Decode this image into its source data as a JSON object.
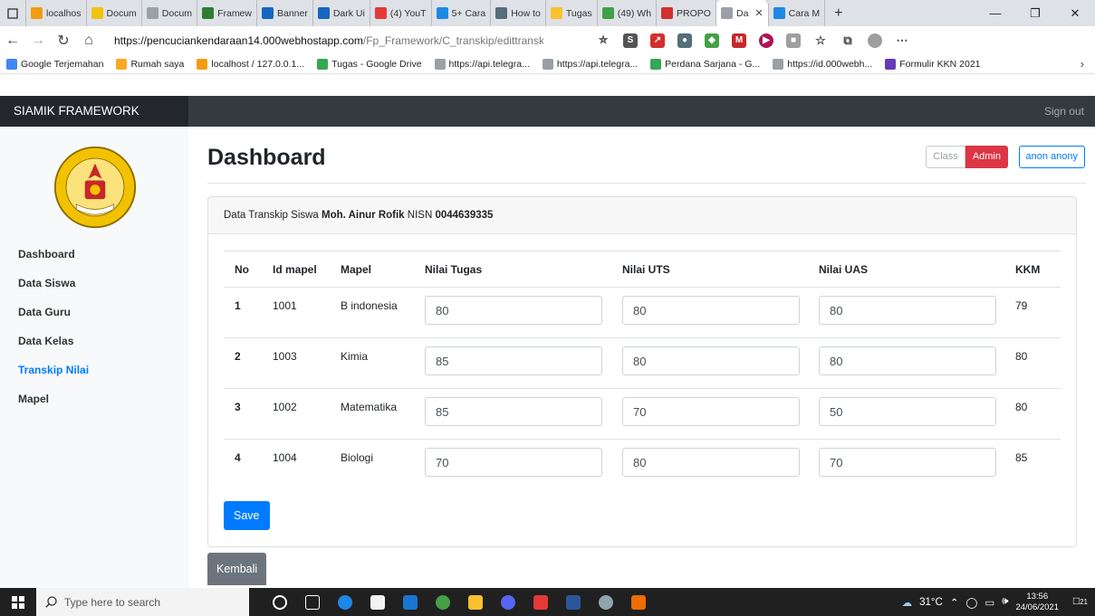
{
  "browser": {
    "tabs": [
      {
        "label": "localhos",
        "color": "#f39c12"
      },
      {
        "label": "Docum",
        "color": "#f1c40f"
      },
      {
        "label": "Docum",
        "color": "#9aa0a6"
      },
      {
        "label": "Framew",
        "color": "#2e7d32"
      },
      {
        "label": "Banner",
        "color": "#1565c0"
      },
      {
        "label": "Dark Ui",
        "color": "#1565c0"
      },
      {
        "label": "(4) YouT",
        "color": "#e53935"
      },
      {
        "label": "5+ Cara",
        "color": "#1e88e5"
      },
      {
        "label": "How to",
        "color": "#546e7a"
      },
      {
        "label": "Tugas",
        "color": "#fbc02d"
      },
      {
        "label": "(49) Wh",
        "color": "#43a047"
      },
      {
        "label": "PROPO",
        "color": "#d32f2f"
      },
      {
        "label": "Da",
        "color": "#9aa0a6",
        "active": true
      },
      {
        "label": "Cara M",
        "color": "#1e88e5"
      }
    ],
    "url_domain": "https://pencuciankendaraan14.000webhostapp.com",
    "url_path": "/Fp_Framework/C_transkip/edittranskip/...",
    "bookmarks": [
      {
        "label": "Google Terjemahan",
        "color": "#4285f4"
      },
      {
        "label": "Rumah saya",
        "color": "#f9a825"
      },
      {
        "label": "localhost / 127.0.0.1...",
        "color": "#f39c12"
      },
      {
        "label": "Tugas - Google Drive",
        "color": "#34a853"
      },
      {
        "label": "https://api.telegra...",
        "color": "#9aa0a6"
      },
      {
        "label": "https://api.telegra...",
        "color": "#9aa0a6"
      },
      {
        "label": "Perdana Sarjana - G...",
        "color": "#34a853"
      },
      {
        "label": "https://id.000webh...",
        "color": "#9aa0a6"
      },
      {
        "label": "Formulir KKN 2021",
        "color": "#673ab7"
      }
    ]
  },
  "navbar": {
    "brand": "SIAMIK FRAMEWORK",
    "signout": "Sign out"
  },
  "sidebar": {
    "items": [
      {
        "label": "Dashboard",
        "active": false
      },
      {
        "label": "Data Siswa",
        "active": false
      },
      {
        "label": "Data Guru",
        "active": false
      },
      {
        "label": "Data Kelas",
        "active": false
      },
      {
        "label": "Transkip Nilai",
        "active": true
      },
      {
        "label": "Mapel",
        "active": false
      }
    ]
  },
  "main": {
    "title": "Dashboard",
    "btn_class": "Class",
    "btn_admin": "Admin",
    "btn_user": "anon anony",
    "header_prefix": "Data Transkip Siswa ",
    "student_name": "Moh. Ainur Rofik",
    "nisn_label": " NISN ",
    "nisn": "0044639335",
    "table": {
      "headers": [
        "No",
        "Id mapel",
        "Mapel",
        "Nilai Tugas",
        "Nilai UTS",
        "Nilai UAS",
        "KKM"
      ],
      "rows": [
        {
          "no": "1",
          "id": "1001",
          "mapel": "B indonesia",
          "tugas": "80",
          "uts": "80",
          "uas": "80",
          "kkm": "79"
        },
        {
          "no": "2",
          "id": "1003",
          "mapel": "Kimia",
          "tugas": "85",
          "uts": "80",
          "uas": "80",
          "kkm": "80"
        },
        {
          "no": "3",
          "id": "1002",
          "mapel": "Matematika",
          "tugas": "85",
          "uts": "70",
          "uas": "50",
          "kkm": "80"
        },
        {
          "no": "4",
          "id": "1004",
          "mapel": "Biologi",
          "tugas": "70",
          "uts": "80",
          "uas": "70",
          "kkm": "85"
        }
      ]
    },
    "save_label": "Save",
    "back_label": "Kembali"
  },
  "taskbar": {
    "search_placeholder": "Type here to search",
    "weather": "31°C",
    "time": "13:56",
    "date": "24/06/2021",
    "notif_count": "21"
  }
}
